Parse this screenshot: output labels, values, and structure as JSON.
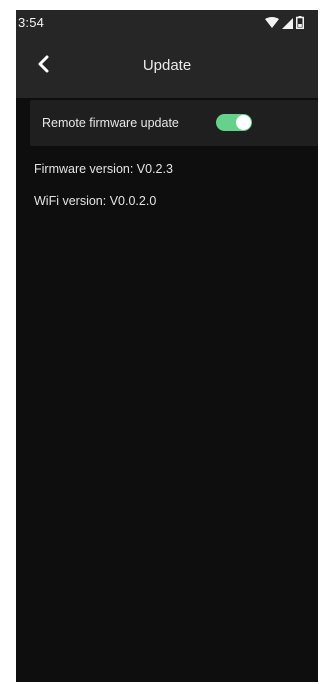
{
  "status_bar": {
    "time": "3:54",
    "icons": [
      "wifi-icon",
      "cell-signal-icon",
      "battery-icon"
    ]
  },
  "app_bar": {
    "back_icon": "chevron-left-icon",
    "title": "Update"
  },
  "settings": {
    "remote_firmware_update": {
      "label": "Remote firmware update",
      "enabled": true,
      "toggle_color": "#66d18b"
    }
  },
  "info": {
    "firmware_version": "Firmware version: V0.2.3",
    "wifi_version": "WiFi version: V0.0.2.0"
  },
  "colors": {
    "background": "#0e0e0e",
    "bar": "#262626",
    "card": "#1f1f1f"
  }
}
